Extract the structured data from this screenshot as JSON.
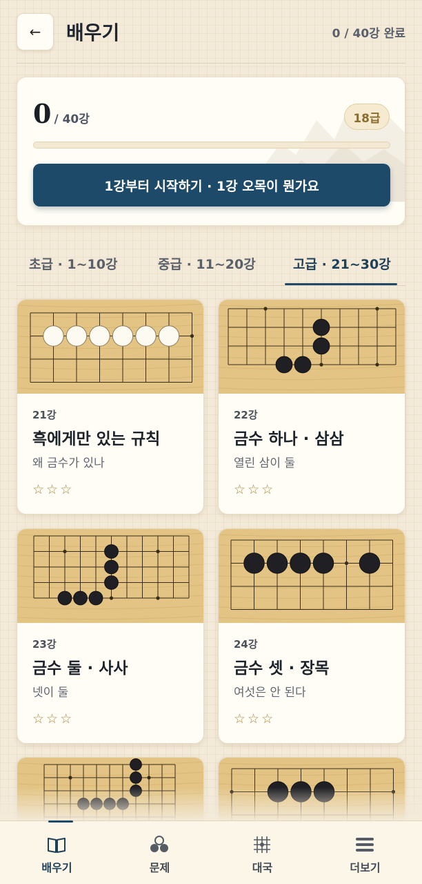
{
  "header": {
    "back_icon": "arrow-left-icon",
    "back_glyph": "←",
    "title": "배우기",
    "completion": "0 / 40강 완료"
  },
  "progress": {
    "completed": "0",
    "total_label": "/ 40강",
    "rank": "18급",
    "fraction": 0,
    "start_button": "1강부터 시작하기 · 1강 오목이 뭔가요"
  },
  "tabs": [
    {
      "label": "초급 · 1~10강",
      "active": false
    },
    {
      "label": "중급 · 11~20강",
      "active": false
    },
    {
      "label": "고급 · 21~30강",
      "active": true
    }
  ],
  "lessons": [
    {
      "number": "21강",
      "title": "흑에게만 있는 규칙",
      "subtitle": "왜 금수가 있나",
      "stars": "☆☆☆"
    },
    {
      "number": "22강",
      "title": "금수 하나 · 삼삼",
      "subtitle": "열린 삼이 둘",
      "stars": "☆☆☆"
    },
    {
      "number": "23강",
      "title": "금수 둘 · 사사",
      "subtitle": "넷이 둘",
      "stars": "☆☆☆"
    },
    {
      "number": "24강",
      "title": "금수 셋 · 장목",
      "subtitle": "여섯은 안 된다",
      "stars": "☆☆☆"
    }
  ],
  "nav": [
    {
      "label": "배우기",
      "icon": "book-icon",
      "active": true
    },
    {
      "label": "문제",
      "icon": "stones-icon",
      "active": false
    },
    {
      "label": "대국",
      "icon": "board-grid-icon",
      "active": false
    },
    {
      "label": "더보기",
      "icon": "menu-icon",
      "active": false
    }
  ],
  "colors": {
    "accent": "#1d4a68",
    "background": "#f3ead9",
    "board": "#e3c485",
    "star": "#a58a45"
  }
}
